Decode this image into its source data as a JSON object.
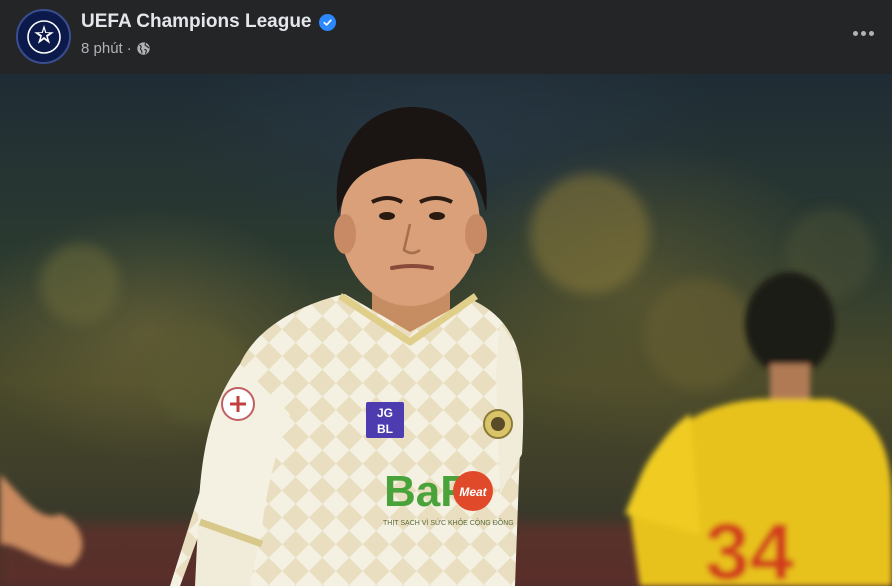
{
  "post": {
    "page_name": "UEFA Champions League",
    "timestamp": "8 phút",
    "separator": "·",
    "verified": true,
    "icons": {
      "avatar": "champions-league-starball-logo",
      "verified": "verified-badge-icon",
      "audience": "globe-icon",
      "menu": "more-options-icon"
    },
    "photo": {
      "sponsor_main": "BaF",
      "sponsor_badge": "Meat",
      "sponsor_tagline": "THỊT SẠCH VÌ SỨC KHỎE CỘNG ĐỒNG",
      "chest_logo": "JG BL",
      "opponent_number": "34"
    }
  },
  "colors": {
    "background": "#242526",
    "text_primary": "#e4e6eb",
    "text_secondary": "#b0b3b8",
    "verified_blue": "#2d88ff"
  }
}
